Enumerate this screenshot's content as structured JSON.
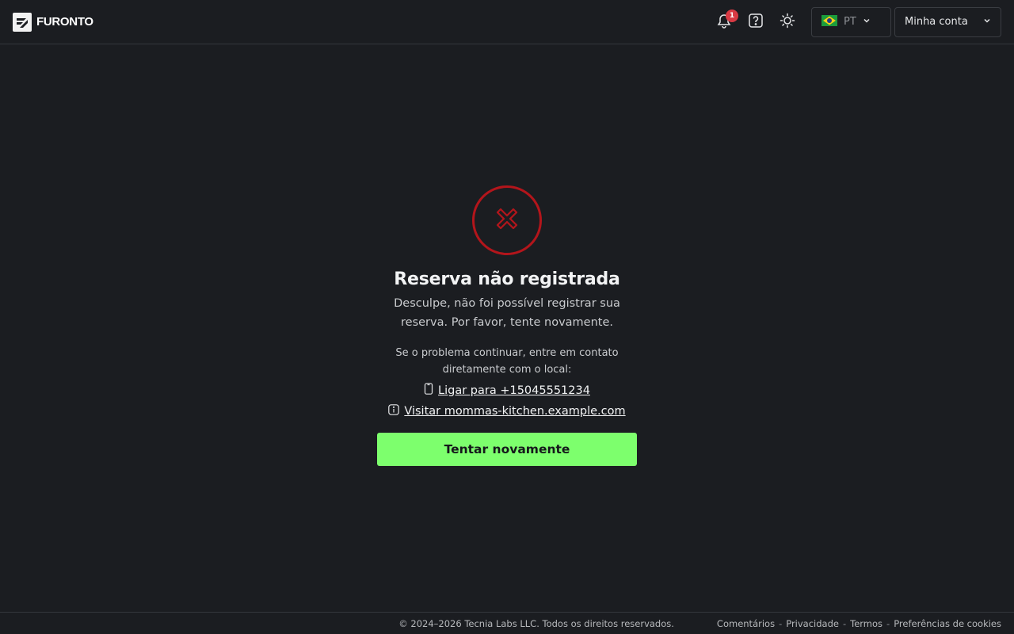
{
  "header": {
    "brand": "FURONTO",
    "notifications": {
      "count": "1",
      "icon": "bell-icon"
    },
    "help_icon": "question-icon",
    "theme_icon": "sun-icon",
    "language": {
      "code": "PT",
      "flag": "brazil-flag-icon"
    },
    "account_label": "Minha conta"
  },
  "main": {
    "status_icon": "x-circle-icon",
    "status_color": "#b3151b",
    "title": "Reserva não registrada",
    "subtitle": "Desculpe, não foi possível registrar sua reserva. Por favor, tente novamente.",
    "help_text": "Se o problema continuar, entre em contato diretamente com o local:",
    "phone_link": "Ligar para +15045551234",
    "website_link": "Visitar mommas-kitchen.example.com",
    "retry_button": "Tentar novamente",
    "accent_color": "#7dff6d"
  },
  "footer": {
    "copyright": "© 2024–2026 Tecnia Labs LLC. Todos os direitos reservados.",
    "links": [
      "Comentários",
      "Privacidade",
      "Termos",
      "Preferências de cookies"
    ],
    "separator": "-"
  }
}
